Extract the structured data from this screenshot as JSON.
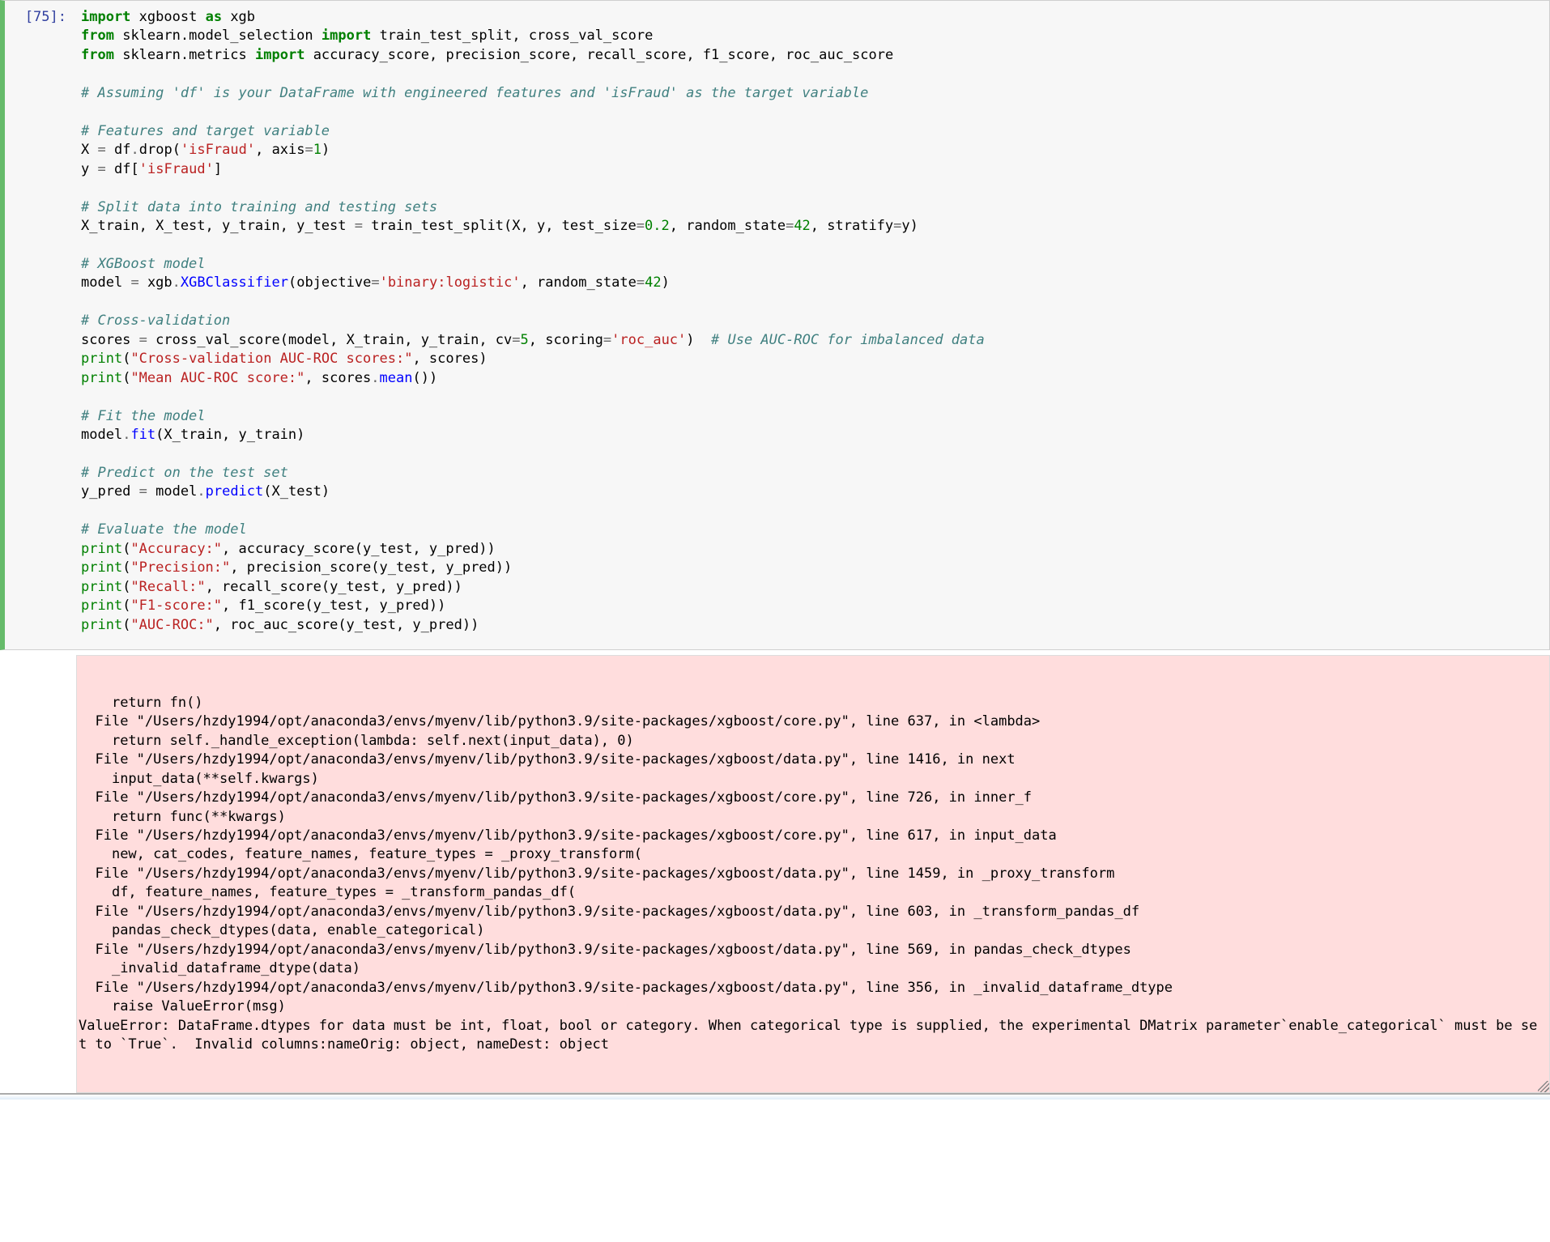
{
  "cell": {
    "prompt_label": "[75]:",
    "code": {
      "l1_import": "import",
      "l1_xgboost": "xgboost",
      "l1_as": "as",
      "l1_xgb": "xgb",
      "l2_from": "from",
      "l2_pkg": "sklearn",
      "l2_dot1": ".",
      "l2_mod": "model_selection",
      "l2_import": "import",
      "l2_a": "train_test_split",
      "l2_comma": ", ",
      "l2_b": "cross_val_score",
      "l3_from": "from",
      "l3_pkg": "sklearn",
      "l3_dot1": ".",
      "l3_mod": "metrics",
      "l3_import": "import",
      "l3_a": "accuracy_score",
      "l3_b": "precision_score",
      "l3_c": "recall_score",
      "l3_d": "f1_score",
      "l3_e": "roc_auc_score",
      "c5": "# Assuming 'df' is your DataFrame with engineered features and 'isFraud' as the target variable",
      "c7": "# Features and target variable",
      "l8_X": "X",
      "l8_eq": "=",
      "l8_df": "df",
      "l8_dot": ".",
      "l8_drop": "drop",
      "l8_lp": "(",
      "l8_s": "'isFraud'",
      "l8_c": ",",
      "l8_axis": "axis",
      "l8_eq2": "=",
      "l8_one": "1",
      "l8_rp": ")",
      "l9_y": "y",
      "l9_eq": "=",
      "l9_df": "df",
      "l9_lb": "[",
      "l9_s": "'isFraud'",
      "l9_rb": "]",
      "c11": "# Split data into training and testing sets",
      "l12_lhs": "X_train, X_test, y_train, y_test",
      "l12_eq": "=",
      "l12_fn": "train_test_split",
      "l12_args1": "(X, y, test_size",
      "l12_eq2": "=",
      "l12_n1": "0.2",
      "l12_c2": ", random_state",
      "l12_eq3": "=",
      "l12_n2": "42",
      "l12_c3": ", stratify",
      "l12_eq4": "=",
      "l12_y": "y)",
      "c14": "# XGBoost model",
      "l15_m": "model",
      "l15_eq": "=",
      "l15_xgb": "xgb",
      "l15_dot": ".",
      "l15_cls": "XGBClassifier",
      "l15_lp": "(objective",
      "l15_eq2": "=",
      "l15_s": "'binary:logistic'",
      "l15_c": ", random_state",
      "l15_eq3": "=",
      "l15_n": "42",
      "l15_rp": ")",
      "c17": "# Cross-validation",
      "l18_sc": "scores",
      "l18_eq": "=",
      "l18_fn": "cross_val_score",
      "l18_a1": "(model, X_train, y_train, cv",
      "l18_eq2": "=",
      "l18_n1": "5",
      "l18_c2": ", scoring",
      "l18_eq3": "=",
      "l18_s": "'roc_auc'",
      "l18_rp": ")  ",
      "l18_cmt": "# Use AUC-ROC for imbalanced data",
      "l19_pr": "print",
      "l19_lp": "(",
      "l19_s": "\"Cross-validation AUC-ROC scores:\"",
      "l19_c": ", scores)",
      "l20_pr": "print",
      "l20_lp": "(",
      "l20_s": "\"Mean AUC-ROC score:\"",
      "l20_c": ", scores",
      "l20_dot": ".",
      "l20_mean": "mean",
      "l20_p": "())",
      "c22": "# Fit the model",
      "l23_m": "model",
      "l23_dot": ".",
      "l23_fit": "fit",
      "l23_args": "(X_train, y_train)",
      "c25": "# Predict on the test set",
      "l26_yp": "y_pred",
      "l26_eq": "=",
      "l26_m": "model",
      "l26_dot": ".",
      "l26_pred": "predict",
      "l26_args": "(X_test)",
      "c28": "# Evaluate the model",
      "l29_pr": "print",
      "l29_lp": "(",
      "l29_s": "\"Accuracy:\"",
      "l29_rest": ", accuracy_score(y_test, y_pred))",
      "l30_pr": "print",
      "l30_lp": "(",
      "l30_s": "\"Precision:\"",
      "l30_rest": ", precision_score(y_test, y_pred))",
      "l31_pr": "print",
      "l31_lp": "(",
      "l31_s": "\"Recall:\"",
      "l31_rest": ", recall_score(y_test, y_pred))",
      "l32_pr": "print",
      "l32_lp": "(",
      "l32_s": "\"F1-score:\"",
      "l32_rest": ", f1_score(y_test, y_pred))",
      "l33_pr": "print",
      "l33_lp": "(",
      "l33_s": "\"AUC-ROC:\"",
      "l33_rest": ", roc_auc_score(y_test, y_pred))"
    }
  },
  "output": {
    "lines": [
      "    return fn()",
      "  File \"/Users/hzdy1994/opt/anaconda3/envs/myenv/lib/python3.9/site-packages/xgboost/core.py\", line 637, in <lambda>",
      "    return self._handle_exception(lambda: self.next(input_data), 0)",
      "  File \"/Users/hzdy1994/opt/anaconda3/envs/myenv/lib/python3.9/site-packages/xgboost/data.py\", line 1416, in next",
      "    input_data(**self.kwargs)",
      "  File \"/Users/hzdy1994/opt/anaconda3/envs/myenv/lib/python3.9/site-packages/xgboost/core.py\", line 726, in inner_f",
      "    return func(**kwargs)",
      "  File \"/Users/hzdy1994/opt/anaconda3/envs/myenv/lib/python3.9/site-packages/xgboost/core.py\", line 617, in input_data",
      "    new, cat_codes, feature_names, feature_types = _proxy_transform(",
      "  File \"/Users/hzdy1994/opt/anaconda3/envs/myenv/lib/python3.9/site-packages/xgboost/data.py\", line 1459, in _proxy_transform",
      "    df, feature_names, feature_types = _transform_pandas_df(",
      "  File \"/Users/hzdy1994/opt/anaconda3/envs/myenv/lib/python3.9/site-packages/xgboost/data.py\", line 603, in _transform_pandas_df",
      "    pandas_check_dtypes(data, enable_categorical)",
      "  File \"/Users/hzdy1994/opt/anaconda3/envs/myenv/lib/python3.9/site-packages/xgboost/data.py\", line 569, in pandas_check_dtypes",
      "    _invalid_dataframe_dtype(data)",
      "  File \"/Users/hzdy1994/opt/anaconda3/envs/myenv/lib/python3.9/site-packages/xgboost/data.py\", line 356, in _invalid_dataframe_dtype",
      "    raise ValueError(msg)",
      "ValueError: DataFrame.dtypes for data must be int, float, bool or category. When categorical type is supplied, the experimental DMatrix parameter`enable_categorical` must be set to `True`.  Invalid columns:nameOrig: object, nameDest: object"
    ]
  }
}
